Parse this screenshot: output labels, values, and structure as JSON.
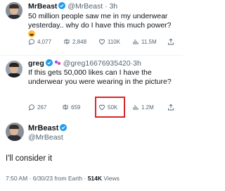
{
  "tweets": [
    {
      "name": "MrBeast",
      "handle": "@MrBeast",
      "time": "3h",
      "text": "50 million people saw me in my underwear yesterday.. why do I have this much power?",
      "replies": "4,077",
      "retweets": "2,848",
      "likes": "110K",
      "views": "11.5M"
    },
    {
      "name": "greg",
      "handle": "@greg16676935420",
      "time": "3h",
      "text": "If this gets 50,000 likes can I have the underwear you were wearing in the picture?",
      "replies": "267",
      "retweets": "659",
      "likes": "50K",
      "views": "1.2M"
    }
  ],
  "main": {
    "name": "MrBeast",
    "handle": "@MrBeast",
    "text": "I'll consider it",
    "meta_time": "7:50 AM · 6/30/23 from Earth · ",
    "meta_views_count": "514K",
    "meta_views_label": "Views"
  },
  "colors": {
    "verified": "#1d9bf0",
    "highlight": "#d9262a"
  }
}
